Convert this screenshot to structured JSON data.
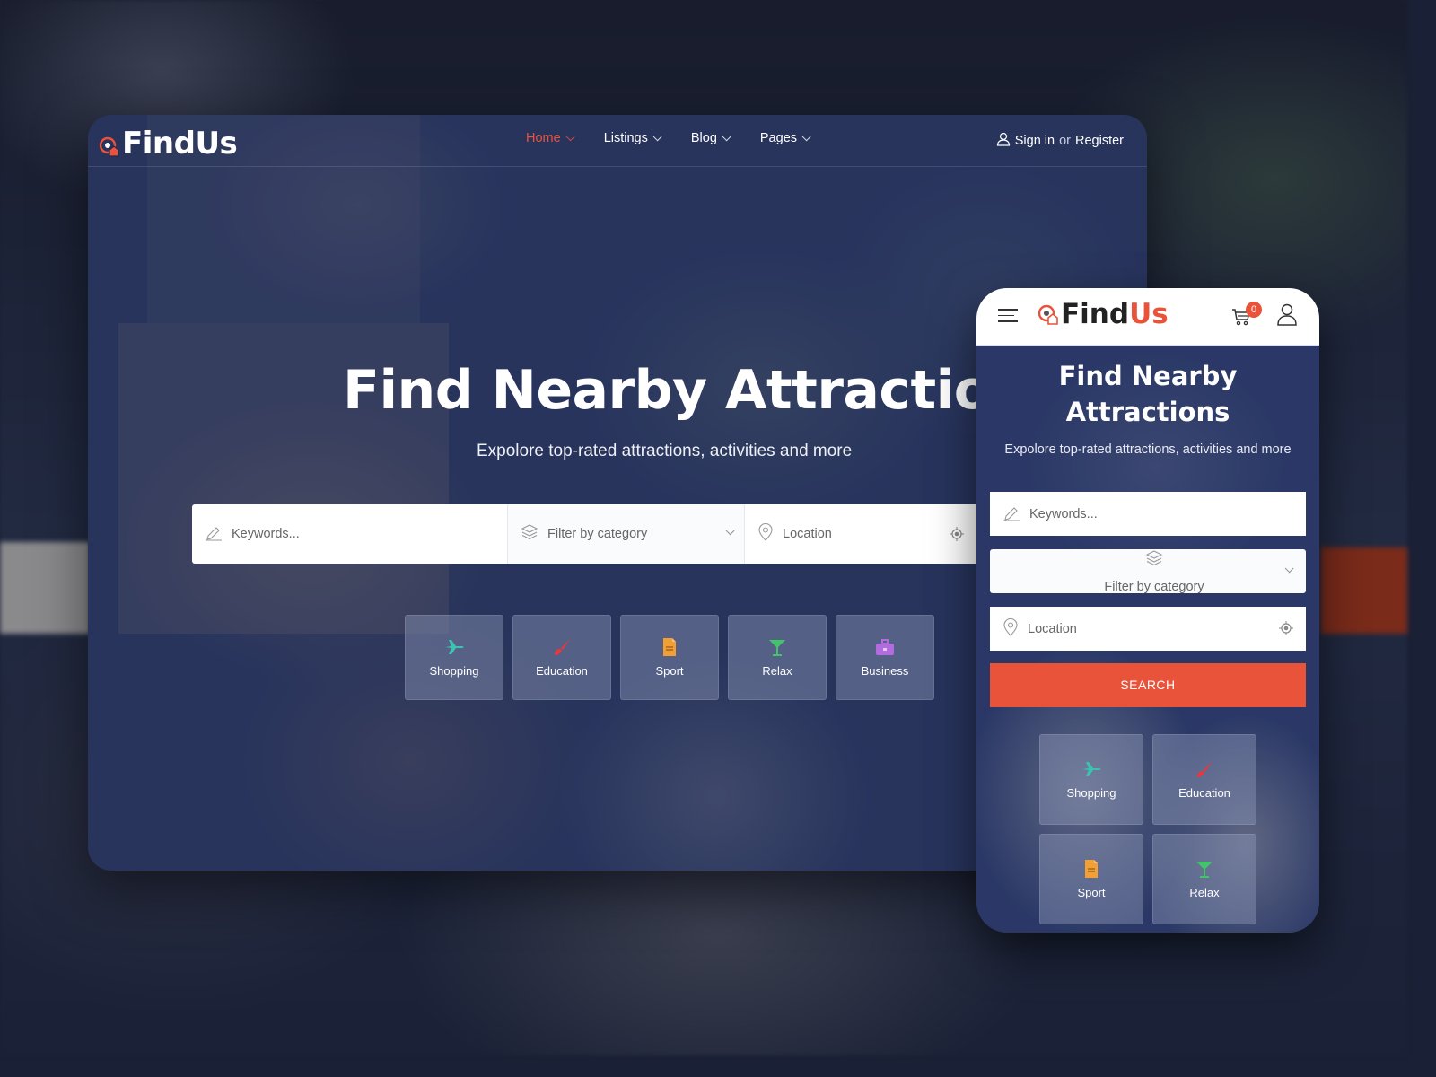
{
  "brand": {
    "name_part1": "Find",
    "name_part2": "Us",
    "accent_color": "#e8533a"
  },
  "desktop": {
    "nav": {
      "items": [
        {
          "label": "Home",
          "active": true
        },
        {
          "label": "Listings",
          "active": false
        },
        {
          "label": "Blog",
          "active": false
        },
        {
          "label": "Pages",
          "active": false
        }
      ],
      "auth": {
        "sign_in": "Sign in",
        "or": "or",
        "register": "Register"
      }
    },
    "hero": {
      "title": "Find Nearby Attractions",
      "subtitle": "Expolore top-rated attractions, activities and more"
    },
    "search": {
      "keywords_placeholder": "Keywords...",
      "category_placeholder": "Filter by category",
      "location_placeholder": "Location"
    },
    "categories": [
      {
        "label": "Shopping",
        "icon": "plane-icon",
        "color": "#3cc3b0"
      },
      {
        "label": "Education",
        "icon": "brush-icon",
        "color": "#e8383d"
      },
      {
        "label": "Sport",
        "icon": "document-icon",
        "color": "#f2a035"
      },
      {
        "label": "Relax",
        "icon": "cocktail-icon",
        "color": "#44c46a"
      },
      {
        "label": "Business",
        "icon": "briefcase-icon",
        "color": "#b36ce0"
      }
    ]
  },
  "mobile": {
    "cart_count": "0",
    "hero": {
      "title_line1": "Find Nearby",
      "title_line2": "Attractions",
      "subtitle": "Expolore top-rated attractions, activities and more"
    },
    "search": {
      "keywords_placeholder": "Keywords...",
      "category_placeholder": "Filter by category",
      "location_placeholder": "Location",
      "button_label": "SEARCH"
    },
    "categories": [
      {
        "label": "Shopping",
        "icon": "plane-icon",
        "color": "#3cc3b0"
      },
      {
        "label": "Education",
        "icon": "brush-icon",
        "color": "#e8383d"
      },
      {
        "label": "Sport",
        "icon": "document-icon",
        "color": "#f2a035"
      },
      {
        "label": "Relax",
        "icon": "cocktail-icon",
        "color": "#44c46a"
      }
    ]
  }
}
